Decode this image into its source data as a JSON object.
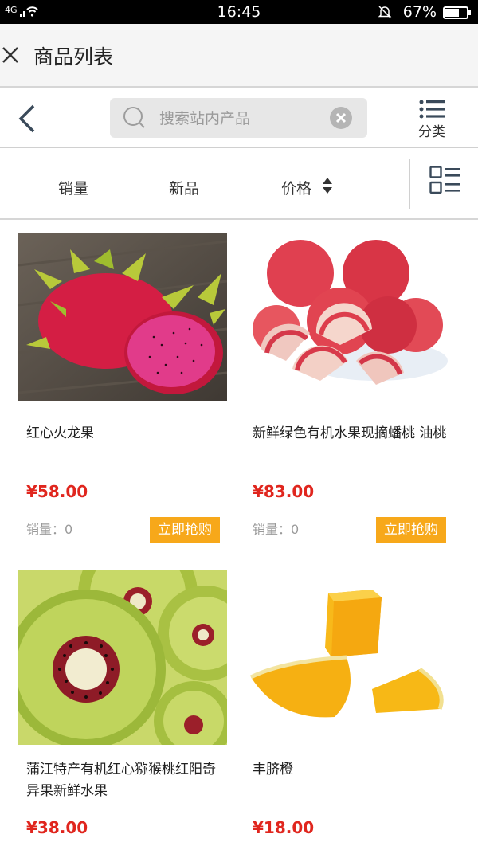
{
  "status_bar": {
    "signal": "4G",
    "time": "16:45",
    "battery": "67%",
    "battery_level": 0.67
  },
  "title_bar": {
    "title": "商品列表"
  },
  "search": {
    "placeholder": "搜索站内产品",
    "category_label": "分类"
  },
  "sort": {
    "sales": "销量",
    "new": "新品",
    "price": "价格"
  },
  "products": [
    {
      "name": "红心火龙果",
      "price": "¥58.00",
      "sales_label": "销量：",
      "sales_count": "0",
      "buy_label": "立即抢购"
    },
    {
      "name": "新鲜绿色有机水果现摘蟠桃 油桃",
      "price": "¥83.00",
      "sales_label": "销量：",
      "sales_count": "0",
      "buy_label": "立即抢购"
    },
    {
      "name": "蒲江特产有机红心猕猴桃红阳奇异果新鲜水果",
      "price": "¥38.00"
    },
    {
      "name": "丰脐橙",
      "price": "¥18.00"
    }
  ],
  "colors": {
    "accent": "#f7a81a",
    "price": "#e0261e"
  }
}
